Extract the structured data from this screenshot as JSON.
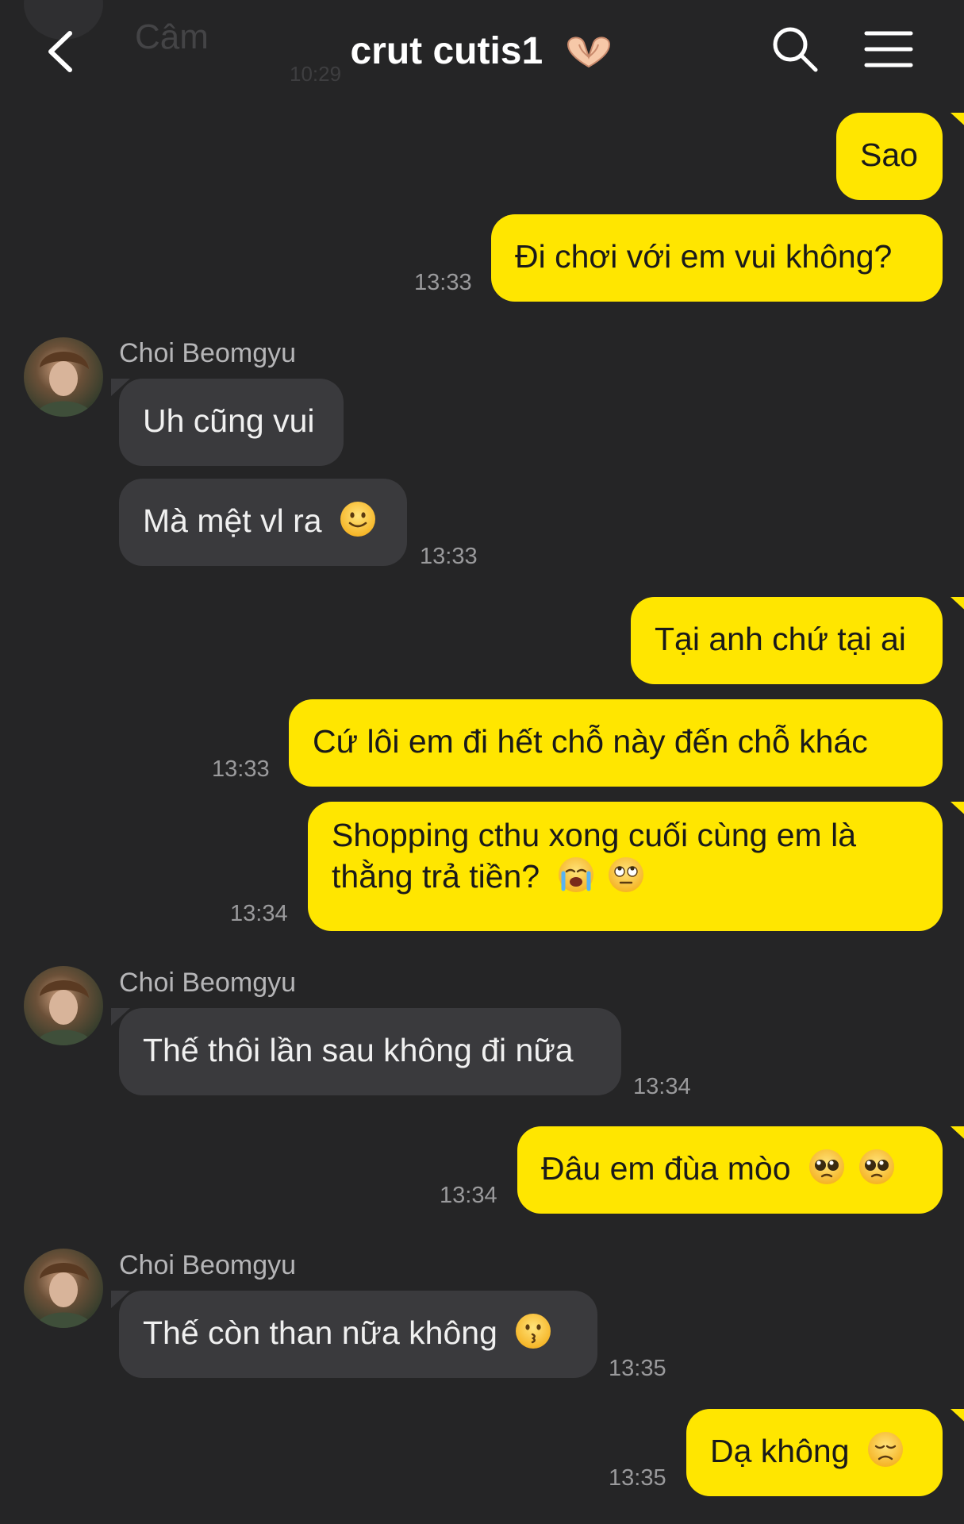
{
  "header": {
    "title": "crut cutis1",
    "title_icon": "heart-hands-icon",
    "back_icon": "chevron-left-icon",
    "search_icon": "search-icon",
    "menu_icon": "hamburger-menu-icon",
    "ghost_text": "Câm",
    "ghost_time": "10:29"
  },
  "colors": {
    "background": "#252526",
    "outgoing_bubble": "#ffe600",
    "incoming_bubble": "#3a3a3d",
    "timestamp": "#9a9a9c"
  },
  "messages": [
    {
      "direction": "out",
      "text": "Sao"
    },
    {
      "direction": "out",
      "text": "Đi chơi với em vui không?",
      "time": "13:33"
    },
    {
      "direction": "in",
      "sender": "Choi Beomgyu",
      "text": "Uh cũng vui"
    },
    {
      "direction": "in",
      "text": "Mà mệt vl ra",
      "emoji": "slightly-smiling-face-icon",
      "time": "13:33"
    },
    {
      "direction": "out",
      "text": "Tại anh chứ tại ai"
    },
    {
      "direction": "out",
      "text": "Cứ lôi em đi hết chỗ này đến chỗ khác",
      "time": "13:33"
    },
    {
      "direction": "out",
      "text": "Shopping cthu xong cuối cùng em là thằng trả tiền?",
      "emoji": "crying-face-icon, eye-roll-face-icon",
      "time": "13:34"
    },
    {
      "direction": "in",
      "sender": "Choi Beomgyu",
      "text": "Thế thôi lần sau không đi nữa",
      "time": "13:34"
    },
    {
      "direction": "out",
      "text": "Đâu em đùa mòo",
      "emoji": "pleading-face-icon, pleading-face-icon",
      "time": "13:34"
    },
    {
      "direction": "in",
      "sender": "Choi Beomgyu",
      "text": "Thế còn than nữa không",
      "emoji": "kissing-face-icon",
      "time": "13:35"
    },
    {
      "direction": "out",
      "text": "Dạ không",
      "emoji": "disappointed-face-icon",
      "time": "13:35"
    }
  ]
}
